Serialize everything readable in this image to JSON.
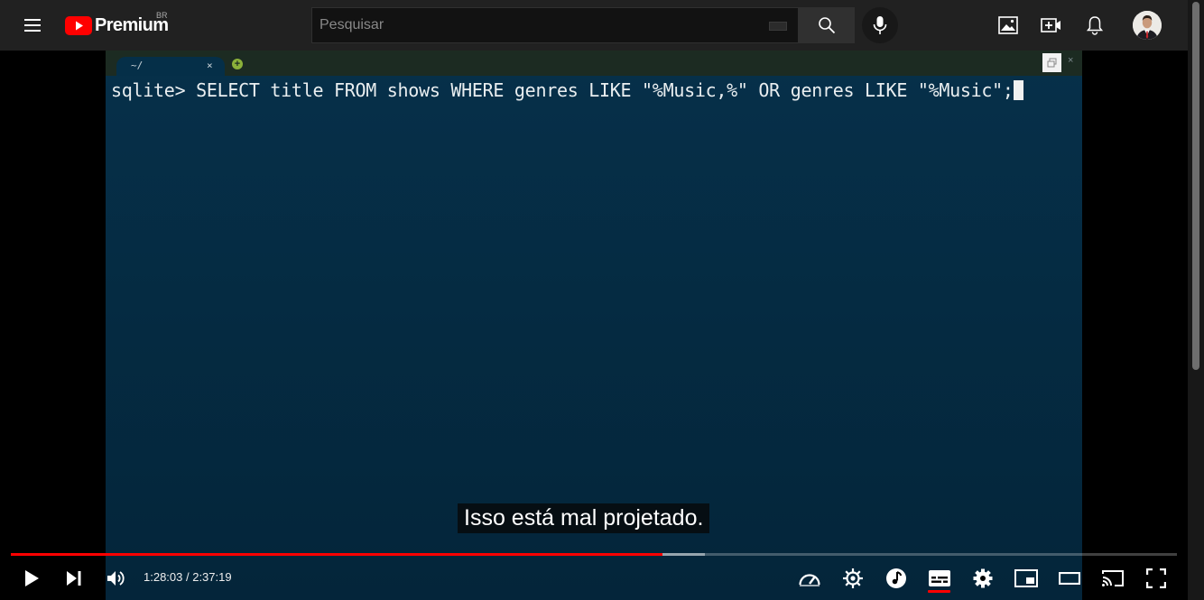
{
  "masthead": {
    "logo_text": "Premium",
    "country_code": "BR",
    "search_placeholder": "Pesquisar",
    "icons": [
      "menu-icon",
      "youtube-logo-icon",
      "keyboard-icon",
      "search-icon",
      "mic-icon",
      "image-icon",
      "create-video-icon",
      "notifications-icon",
      "avatar"
    ]
  },
  "terminal": {
    "tab_title": "~/",
    "tab_close": "×",
    "new_tab": "+",
    "close": "×",
    "command_line": "sqlite> SELECT title FROM shows WHERE genres LIKE \"%Music,%\" OR genres LIKE \"%Music\";"
  },
  "player": {
    "caption": "Isso está mal projetado.",
    "time": "1:28:03 / 2:37:19",
    "progress_played_fraction": 0.559,
    "progress_buffered_fraction": 0.595,
    "controls": [
      "play-icon",
      "next-icon",
      "volume-icon",
      "playback-speed-icon",
      "stable-volume-icon",
      "music-icon",
      "subtitles-icon",
      "settings-icon",
      "miniplayer-icon",
      "theater-mode-icon",
      "cast-icon",
      "fullscreen-icon"
    ],
    "accent_color": "#ff0000"
  }
}
